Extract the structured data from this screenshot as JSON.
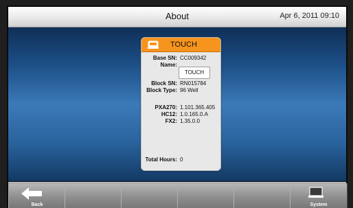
{
  "header": {
    "title": "About",
    "datetime": "Apr 6, 2011 09:10"
  },
  "card": {
    "title": "TOUCH",
    "icon": "instrument-icon",
    "base_sn_label": "Base SN:",
    "base_sn": "CC009342",
    "name_label": "Name:",
    "name_value": "TOUCH",
    "block_sn_label": "Block SN:",
    "block_sn": "RN015784",
    "block_type_label": "Block Type:",
    "block_type": "96 Well",
    "pxa270_label": "PXA270:",
    "pxa270": "1.101.365.405",
    "hc12_label": "HC12:",
    "hc12": "1.0.165.0.A",
    "fx2_label": "FX2:",
    "fx2": "1.35.0.0",
    "total_hours_label": "Total Hours:",
    "total_hours": "0"
  },
  "bottom_bar": {
    "back_label": "Back",
    "system_label": "System"
  },
  "colors": {
    "accent": "#f7941d",
    "content_blue": "#2a639d"
  }
}
